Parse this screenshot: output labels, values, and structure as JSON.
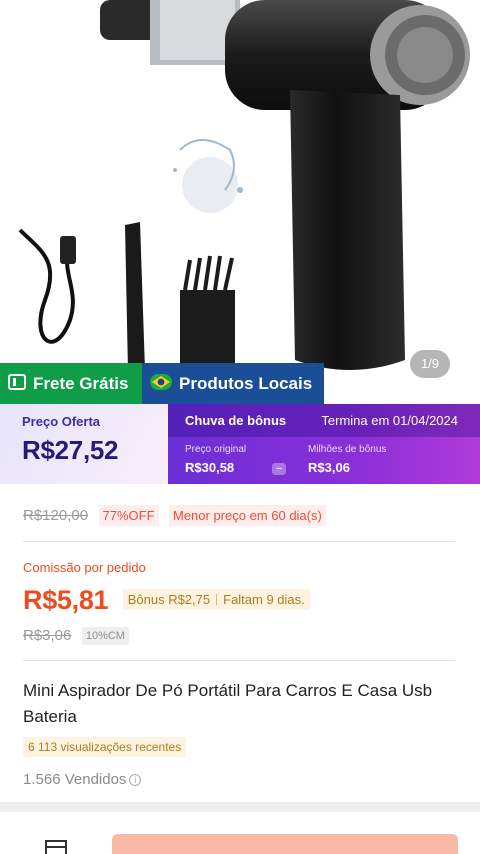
{
  "gallery": {
    "counter": "1/9"
  },
  "badges": {
    "shipping": "Frete Grátis",
    "local": "Produtos Locais"
  },
  "offer": {
    "label": "Preço Oferta",
    "price": "R$27,52",
    "bonus_title": "Chuva de bônus",
    "ends": "Termina em 01/04/2024",
    "original_label": "Preço original",
    "original_value": "R$30,58",
    "operator": "–",
    "bonus_label": "Milhões de bônus",
    "bonus_value": "R$3,06"
  },
  "pricing": {
    "old_price": "R$120,00",
    "discount": "77%OFF",
    "lowest": "Menor preço em 60 dia(s)"
  },
  "commission": {
    "label": "Comissão por pedido",
    "value": "R$5,81",
    "bonus": "Bônus R$2,75",
    "remaining": "Faltam 9 dias.",
    "old": "R$3,06",
    "rate": "10%CM"
  },
  "product": {
    "title": "Mini Aspirador De Pó Portátil Para Carros E Casa Usb Bateria",
    "views": "6 113 visualizações recentes",
    "sold": "1.566 Vendidos"
  },
  "colors": {
    "green_badge": "#0f9d4a",
    "blue_badge": "#1a4e96",
    "accent_orange": "#f04a1f",
    "bonus_purple": "#7a2fd8"
  },
  "icons": [
    "store-icon",
    "brazil-flag-icon",
    "info-icon",
    "shipping-icon"
  ]
}
